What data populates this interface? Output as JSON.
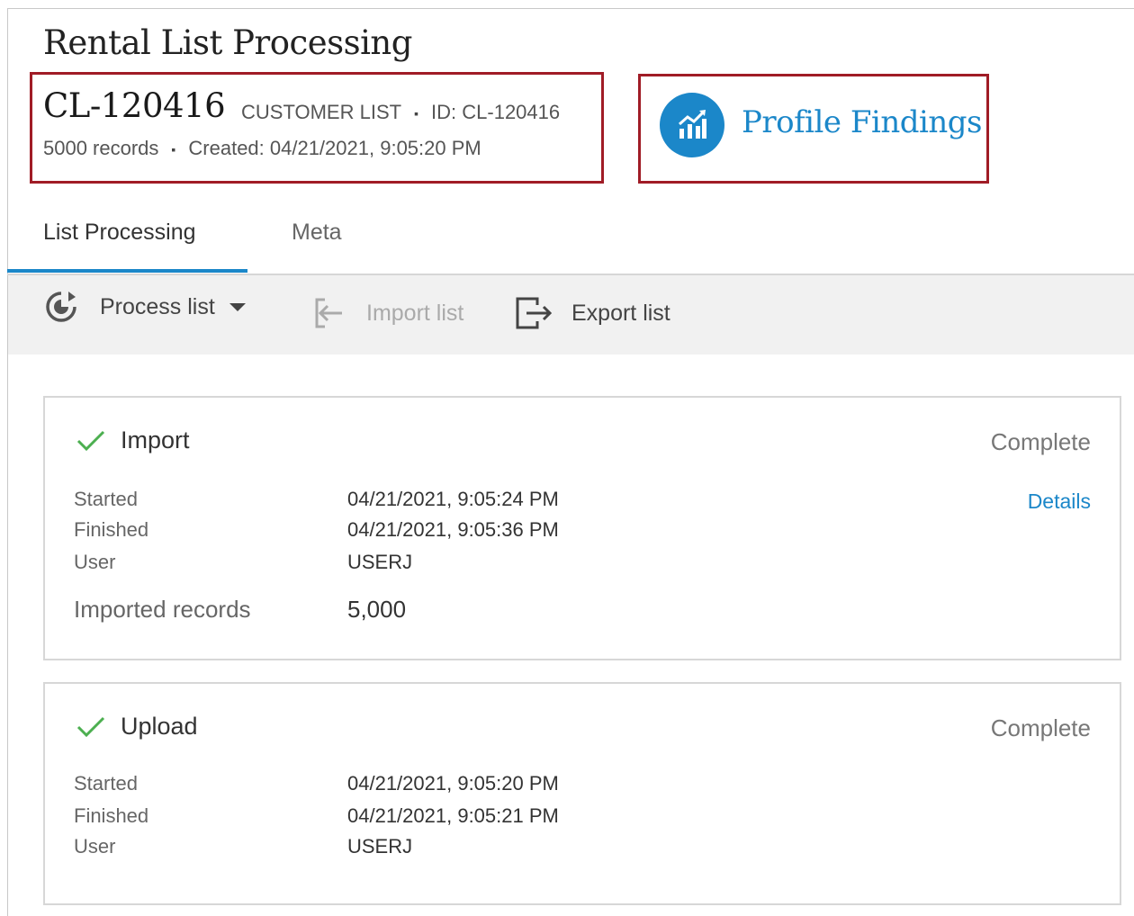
{
  "header": {
    "title": "Rental List Processing",
    "list_id": "CL-120416",
    "list_type": "CUSTOMER LIST",
    "id_text": "ID: CL-120416",
    "records": "5000 records",
    "created": "Created: 04/21/2021, 9:05:20 PM",
    "separator": "▪"
  },
  "profile_findings": {
    "label": "Profile Findings",
    "icon": "chart-trend-icon"
  },
  "tabs": [
    {
      "label": "List Processing",
      "active": true
    },
    {
      "label": "Meta",
      "active": false
    }
  ],
  "toolbar": {
    "process_label": "Process list",
    "import_label": "Import list",
    "export_label": "Export list"
  },
  "steps": {
    "import": {
      "title": "Import",
      "status": "Complete",
      "details_label": "Details",
      "started_label": "Started",
      "started_value": "04/21/2021, 9:05:24 PM",
      "finished_label": "Finished",
      "finished_value": "04/21/2021, 9:05:36 PM",
      "user_label": "User",
      "user_value": "USERJ",
      "records_label": "Imported records",
      "records_value": "5,000"
    },
    "upload": {
      "title": "Upload",
      "status": "Complete",
      "started_label": "Started",
      "started_value": "04/21/2021, 9:05:20 PM",
      "finished_label": "Finished",
      "finished_value": "04/21/2021, 9:05:21 PM",
      "user_label": "User",
      "user_value": "USERJ"
    }
  },
  "colors": {
    "accent": "#1b87c9",
    "highlight": "#a01c26",
    "success": "#4caf50"
  }
}
